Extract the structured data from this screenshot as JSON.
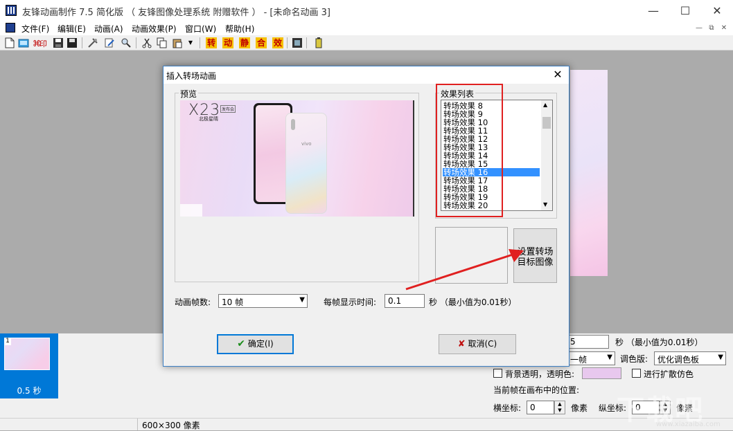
{
  "window": {
    "title": "友锋动画制作 7.5 简化版 （ 友锋图像处理系统 附赠软件 ） - [未命名动画 3]",
    "minimize": "—",
    "maximize": "☐",
    "close": "✕"
  },
  "menu": {
    "items": [
      "文件(F)",
      "编辑(E)",
      "动画(A)",
      "动画效果(P)",
      "窗口(W)",
      "帮助(H)"
    ],
    "mdi_min": "—",
    "mdi_restore": "⧉",
    "mdi_close": "✕"
  },
  "toolbar": {
    "icons": [
      "new-icon",
      "open-icon",
      "import-icon",
      "save-icon",
      "tools-icon",
      "edit-icon",
      "zoom-icon",
      "cut-icon",
      "copy-icon",
      "paste-icon",
      "paste-dropdown-icon",
      "effect-transition-icon",
      "effect-move-icon",
      "effect-static-icon",
      "effect-combine-icon",
      "effect-special-icon",
      "film-icon",
      "battery-icon"
    ],
    "effect_labels": [
      "转",
      "动",
      "静",
      "合",
      "效"
    ],
    "colors": {
      "effect_text": "#c00000",
      "effect_bg": "#f6c000"
    }
  },
  "dialog": {
    "title": "插入转场动画",
    "close": "✕",
    "preview_label": "预览",
    "preview_image": {
      "brand": "X23",
      "badge": "发布会",
      "subtitle": "北极星晴",
      "logo": "vivo"
    },
    "effects_label": "效果列表",
    "effects": [
      "转场效果 8",
      "转场效果 9",
      "转场效果 10",
      "转场效果 11",
      "转场效果 12",
      "转场效果 13",
      "转场效果 14",
      "转场效果 15",
      "转场效果 16",
      "转场效果 17",
      "转场效果 18",
      "转场效果 19",
      "转场效果 20"
    ],
    "selected_effect": "转场效果 16",
    "set_target_button": "设置转场目标图像",
    "frames_label": "动画帧数:",
    "frames_value": "10 帧",
    "frame_time_label": "每帧显示时间:",
    "frame_time_value": "0.1",
    "frame_time_unit": "秒 （最小值为0.01秒）",
    "ok_button": "确定(I)",
    "ok_icon": "✔",
    "cancel_button": "取消(C)",
    "cancel_icon": "✘",
    "colors": {
      "highlight_box": "#e02020",
      "arrow": "#e02020",
      "selection": "#3391ff"
    }
  },
  "thumbnail": {
    "number": "1",
    "label": "0.5 秒"
  },
  "properties": {
    "time_value": "5",
    "time_unit": "秒 （最小值为0.01秒）",
    "frame_combo": "一帧",
    "palette_label": "调色版:",
    "palette_value": "优化调色板",
    "transparent_label": "背景透明，透明色:",
    "transparent_color": "#e8c8ee",
    "dither_label": "进行扩散仿色",
    "position_label": "当前帧在画布中的位置:",
    "x_label": "横坐标:",
    "x_value": "0",
    "x_unit": "像素",
    "y_label": "纵坐标:",
    "y_value": "0",
    "y_unit": "像素"
  },
  "status": {
    "size": "600×300 像素"
  },
  "watermark": {
    "text": "下载吧",
    "url": "www.xiazaiba.com"
  }
}
